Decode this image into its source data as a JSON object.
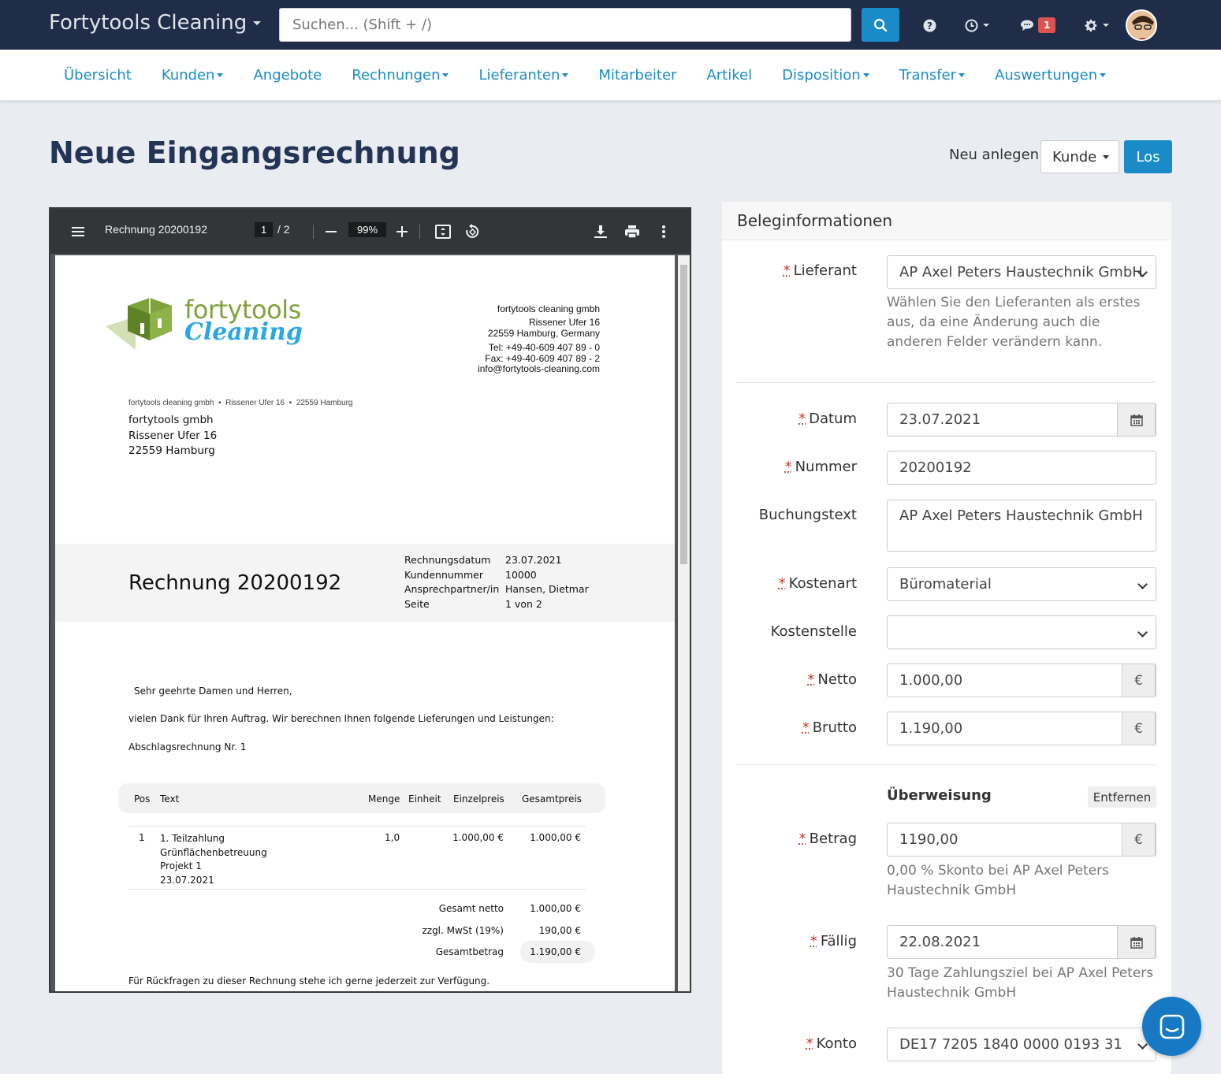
{
  "topbar": {
    "brand": "Fortytools Cleaning",
    "search_placeholder": "Suchen... (Shift + /)",
    "notifications_count": "1"
  },
  "nav": {
    "items": [
      {
        "label": "Übersicht",
        "dropdown": false
      },
      {
        "label": "Kunden",
        "dropdown": true
      },
      {
        "label": "Angebote",
        "dropdown": false
      },
      {
        "label": "Rechnungen",
        "dropdown": true
      },
      {
        "label": "Lieferanten",
        "dropdown": true
      },
      {
        "label": "Mitarbeiter",
        "dropdown": false
      },
      {
        "label": "Artikel",
        "dropdown": false
      },
      {
        "label": "Disposition",
        "dropdown": true
      },
      {
        "label": "Transfer",
        "dropdown": true
      },
      {
        "label": "Auswertungen",
        "dropdown": true
      }
    ]
  },
  "page": {
    "title": "Neue Eingangsrechnung",
    "new_label": "Neu anlegen:",
    "new_select": "Kunde",
    "go_button": "Los"
  },
  "pdf": {
    "filename": "Rechnung 20200192",
    "page_current": "1",
    "page_total": "/ 2",
    "zoom": "99%",
    "logo_top": "fortytools",
    "logo_bottom": "Cleaning",
    "sender": {
      "company": "fortytools cleaning gmbh",
      "street": "Rissener Ufer 16",
      "city": "22559 Hamburg, Germany",
      "tel": "Tel: +49-40-609 407 89 - 0",
      "fax": "Fax: +49-40-609 407 89 - 2",
      "email": "info@fortytools-cleaning.com"
    },
    "return_line": {
      "a": "fortytools cleaning gmbh",
      "b": "Rissener Ufer 16",
      "c": "22559 Hamburg"
    },
    "recipient": {
      "name": "fortytools gmbh",
      "street": "Rissener Ufer 16",
      "city": "22559 Hamburg"
    },
    "invoice_title": "Rechnung 20200192",
    "meta": [
      {
        "k": "Rechnungsdatum",
        "v": "23.07.2021"
      },
      {
        "k": "Kundennummer",
        "v": "10000"
      },
      {
        "k": "Ansprechpartner/in",
        "v": "Hansen, Dietmar"
      },
      {
        "k": "Seite",
        "v": "1 von 2"
      }
    ],
    "salutation": "Sehr geehrte Damen und Herren,",
    "intro": "vielen Dank für Ihren Auftrag. Wir berechnen Ihnen folgende Lieferungen und Leistungen:",
    "subject": "Abschlagsrechnung Nr. 1",
    "table_head": {
      "pos": "Pos",
      "text": "Text",
      "menge": "Menge",
      "einheit": "Einheit",
      "einzel": "Einzelpreis",
      "gesamt": "Gesamtpreis"
    },
    "row": {
      "pos": "1",
      "text1": "1. Teilzahlung",
      "text2": "Grünflächenbetreuung",
      "text3": "Projekt 1",
      "text4": "23.07.2021",
      "menge": "1,0",
      "einzel": "1.000,00 €",
      "gesamt": "1.000,00 €"
    },
    "totals": [
      {
        "k": "Gesamt netto",
        "v": "1.000,00 €"
      },
      {
        "k": "zzgl. MwSt (19%)",
        "v": "190,00 €"
      },
      {
        "k": "Gesamtbetrag",
        "v": "1.190,00 €"
      }
    ],
    "closing": "Für Rückfragen zu dieser Rechnung stehe ich gerne jederzeit zur Verfügung."
  },
  "form": {
    "title": "Beleginformationen",
    "req": "*",
    "lieferant": {
      "label": "Lieferant",
      "value": "AP Axel Peters Haustechnik GmbH",
      "help": "Wählen Sie den Lieferanten als erstes aus, da eine Änderung auch die anderen Felder verändern kann."
    },
    "datum": {
      "label": "Datum",
      "value": "23.07.2021"
    },
    "nummer": {
      "label": "Nummer",
      "value": "20200192"
    },
    "buchungstext": {
      "label": "Buchungstext",
      "value": "AP Axel Peters Haustechnik GmbH"
    },
    "kostenart": {
      "label": "Kostenart",
      "value": "Büromaterial"
    },
    "kostenstelle": {
      "label": "Kostenstelle",
      "value": ""
    },
    "netto": {
      "label": "Netto",
      "value": "1.000,00",
      "unit": "€"
    },
    "brutto": {
      "label": "Brutto",
      "value": "1.190,00",
      "unit": "€"
    },
    "ueberweisung": {
      "title": "Überweisung",
      "remove": "Entfernen"
    },
    "betrag": {
      "label": "Betrag",
      "value": "1190,00",
      "unit": "€",
      "help": "0,00 % Skonto bei AP Axel Peters Haustechnik GmbH"
    },
    "faellig": {
      "label": "Fällig",
      "value": "22.08.2021",
      "help": "30 Tage Zahlungsziel bei AP Axel Peters Haustechnik GmbH"
    },
    "konto": {
      "label": "Konto",
      "value": "DE17 7205 1840 0000 0193 31"
    }
  },
  "colors": {
    "navy": "#1f2d49",
    "accent": "#1a8bc7",
    "title": "#243455",
    "logo_green": "#7fa23c",
    "logo_blue": "#2aa8e0"
  }
}
